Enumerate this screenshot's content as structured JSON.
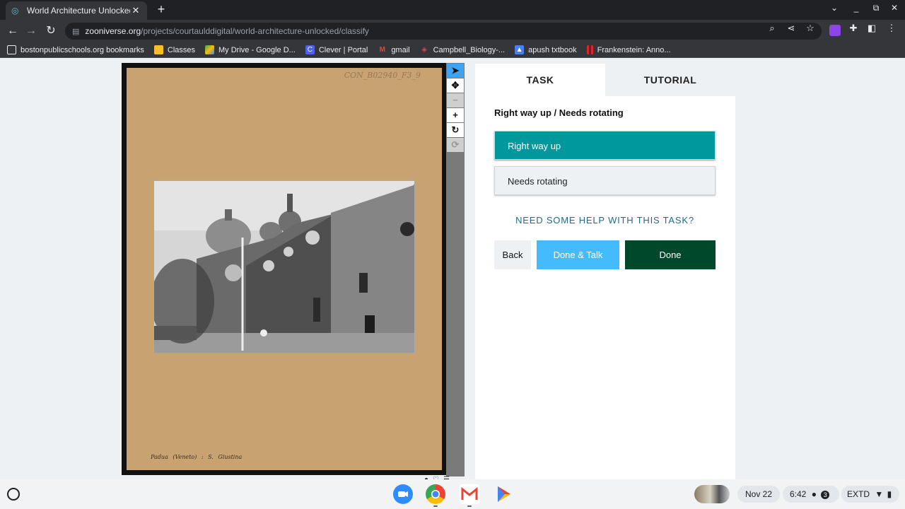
{
  "browser": {
    "tab": {
      "title": "World Architecture Unlocked » C",
      "icon": "zooniverse-icon"
    },
    "url_host": "zooniverse.org",
    "url_path": "/projects/courtaulddigital/world-architecture-unlocked/classify"
  },
  "bookmarks": [
    {
      "label": "bostonpublicschools.org bookmarks",
      "icon": "folder-icon",
      "color": "#e8eaed"
    },
    {
      "label": "Classes",
      "icon": "google-classroom-icon",
      "color": "#f9bc2c"
    },
    {
      "label": "My Drive - Google D...",
      "icon": "google-drive-icon",
      "color": "#34a853"
    },
    {
      "label": "Clever | Portal",
      "icon": "clever-icon",
      "color": "#4c63e8"
    },
    {
      "label": "gmail",
      "icon": "gmail-icon",
      "color": "#ea4335"
    },
    {
      "label": "Campbell_Biology-...",
      "icon": "campbell-icon",
      "color": "#e0434b"
    },
    {
      "label": "apush txtbook",
      "icon": "person-icon",
      "color": "#4a7ff0"
    },
    {
      "label": "Frankenstein: Anno...",
      "icon": "bookmark-red-icon",
      "color": "#e0242b"
    }
  ],
  "subject": {
    "catalog_number": "CON_B02940_F3_9",
    "caption": "Padua (Veneto) : S. Giustina"
  },
  "task_panel": {
    "tabs": [
      "TASK",
      "TUTORIAL"
    ],
    "question": "Right way up / Needs rotating",
    "answers": [
      "Right way up",
      "Needs rotating"
    ],
    "help_link": "NEED SOME HELP WITH THIS TASK?",
    "buttons": {
      "back": "Back",
      "done_talk": "Done & Talk",
      "done": "Done"
    }
  },
  "shelf": {
    "date": "Nov 22",
    "time": "6:42",
    "notification_count": "3",
    "network": "EXTD"
  },
  "colors": {
    "answer_selected": "#00979d",
    "done_talk": "#43bbfd",
    "done": "#00482b",
    "help_link": "#1f6b86"
  }
}
